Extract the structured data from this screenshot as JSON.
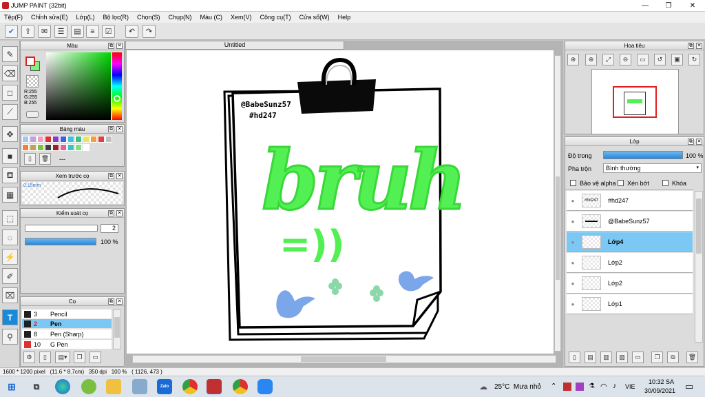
{
  "app": {
    "title": "JUMP PAINT (32bit)",
    "min": "—",
    "max": "❐",
    "close": "✕"
  },
  "menu": [
    "Tệp(F)",
    "Chỉnh sửa(E)",
    "Lớp(L)",
    "Bộ lọc(R)",
    "Chọn(S)",
    "Chụp(N)",
    "Màu (C)",
    "Xem(V)",
    "Công cụ(T)",
    "Cửa sổ(W)",
    "Help"
  ],
  "color_panel": {
    "title": "Màu",
    "r": "R:255",
    "g": "G:255",
    "b": "B:255",
    "fg": "#ffffff",
    "bg": "#80f080"
  },
  "palette_panel": {
    "title": "Bảng màu",
    "colors": [
      "#a0c8f0",
      "#c0a0e0",
      "#f0a0c0",
      "#e03030",
      "#8040c0",
      "#4060e0",
      "#40c0e0",
      "#40c080",
      "#f0e060",
      "#f0a040",
      "#e04040",
      "#c0c0c0",
      "#f08040",
      "#c0a060",
      "#80c040",
      "#404040",
      "#a02020",
      "#e060a0",
      "#40c0c0",
      "#80e080",
      "#ffffff"
    ],
    "more": "---"
  },
  "preview_panel": {
    "title": "Xem trước cọ",
    "size": "0.15mm"
  },
  "control_panel": {
    "title": "Kiểm soát cọ",
    "size_value": "2",
    "opacity_value": "100 %",
    "opacity": 1.0
  },
  "brush_panel": {
    "title": "Cọ",
    "items": [
      {
        "num": "3",
        "label": "Pencil",
        "color": "#202020",
        "selected": false
      },
      {
        "num": "2",
        "label": "Pen",
        "color": "#202020",
        "selected": true
      },
      {
        "num": "8",
        "label": "Pen (Sharp)",
        "color": "#202020",
        "selected": false
      },
      {
        "num": "10",
        "label": "G Pen",
        "color": "#e03030",
        "selected": false
      }
    ]
  },
  "canvas": {
    "tab": "Untitled",
    "handle": "@BabeSunz57",
    "tag": "#hd247",
    "word": "bruh",
    "emote": "=))"
  },
  "nav_panel": {
    "title": "Hoa tiêu"
  },
  "layer_panel": {
    "title": "Lớp",
    "opacity_label": "Độ trong",
    "opacity_value": "100 %",
    "opacity": 1.0,
    "blend_label": "Pha trộn",
    "blend_value": "Bình thường",
    "protect_alpha": "Bảo vệ alpha",
    "clip": "Xén bớt",
    "lock": "Khóa",
    "layers": [
      {
        "name": "#hd247",
        "thumb": "#hd247",
        "selected": false
      },
      {
        "name": "@BabeSunz57",
        "thumb": "▬▬▬",
        "selected": false
      },
      {
        "name": "Lớp4",
        "thumb": "",
        "selected": true
      },
      {
        "name": "Lớp2",
        "thumb": "",
        "selected": false
      },
      {
        "name": "Lớp2",
        "thumb": "",
        "selected": false
      },
      {
        "name": "Lớp1",
        "thumb": "",
        "selected": false
      }
    ]
  },
  "status": {
    "text": "1600 * 1200 pixel   (11.6 * 8.7cm)   350 dpi   100 %   ( 1126, 473 )"
  },
  "taskbar": {
    "weather": "25°C  Mưa nhỏ",
    "lang": "VIE",
    "time": "10:32 SA",
    "date": "30/09/2021",
    "zalo": "Zalo"
  }
}
